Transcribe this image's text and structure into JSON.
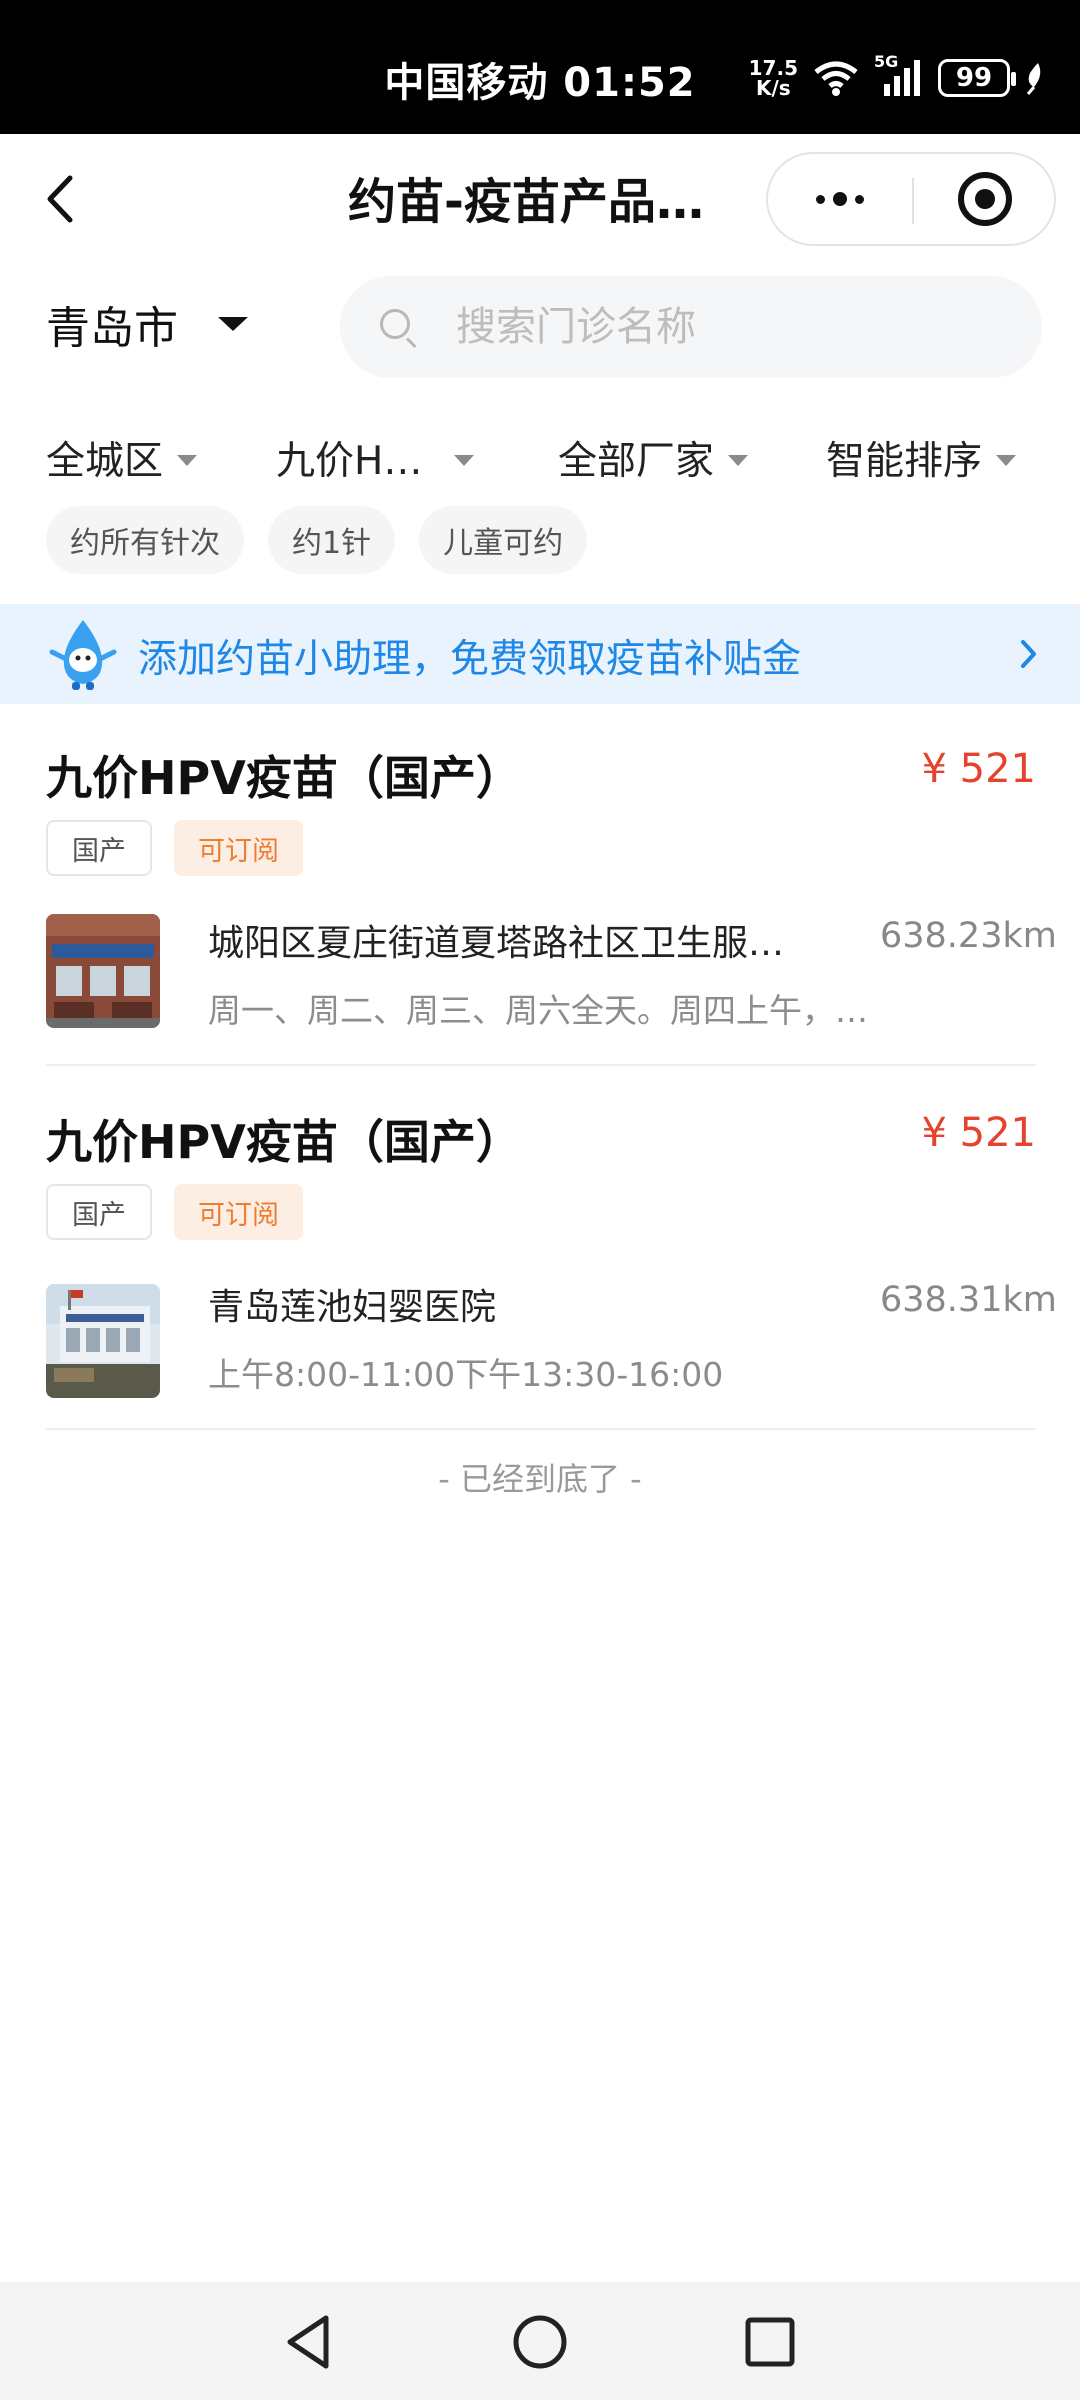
{
  "status_bar": {
    "carrier_time": "中国移动 01:52",
    "net_speed_value": "17.5",
    "net_speed_unit": "K/s",
    "signal_label": "5G",
    "battery": "99"
  },
  "nav": {
    "title": "约苗-疫苗产品列表"
  },
  "city": {
    "label": "青岛市"
  },
  "search": {
    "placeholder": "搜索门诊名称"
  },
  "filters": [
    {
      "label": "全城区"
    },
    {
      "label": "九价H…"
    },
    {
      "label": "全部厂家"
    },
    {
      "label": "智能排序"
    }
  ],
  "chips": [
    "约所有针次",
    "约1针",
    "儿童可约"
  ],
  "banner": {
    "text": "添加约苗小助理，免费领取疫苗补贴金"
  },
  "products": [
    {
      "title": "九价HPV疫苗（国产）",
      "price": "¥ 521",
      "tags": [
        "国产",
        "可订阅"
      ],
      "clinic_name": "城阳区夏庄街道夏塔路社区卫生服务站",
      "distance": "638.23km",
      "hours": "周一、周二、周三、周六全天。周四上午，周五下午"
    },
    {
      "title": "九价HPV疫苗（国产）",
      "price": "¥ 521",
      "tags": [
        "国产",
        "可订阅"
      ],
      "clinic_name": "青岛莲池妇婴医院",
      "distance": "638.31km",
      "hours": "上午8:00-11:00下午13:30-16:00"
    }
  ],
  "end_text": "- 已经到底了 -",
  "colors": {
    "price": "#e5432d",
    "banner_bg": "#e8f3fe",
    "banner_text": "#1f87e6",
    "tag_orange": "#ee7d33"
  },
  "icons": [
    "back-arrow-icon",
    "more-dots-icon",
    "close-target-icon",
    "caret-down-icon",
    "search-icon",
    "mascot-icon",
    "chevron-right-icon",
    "wifi-icon",
    "signal-icon",
    "battery-icon",
    "leaf-icon"
  ]
}
